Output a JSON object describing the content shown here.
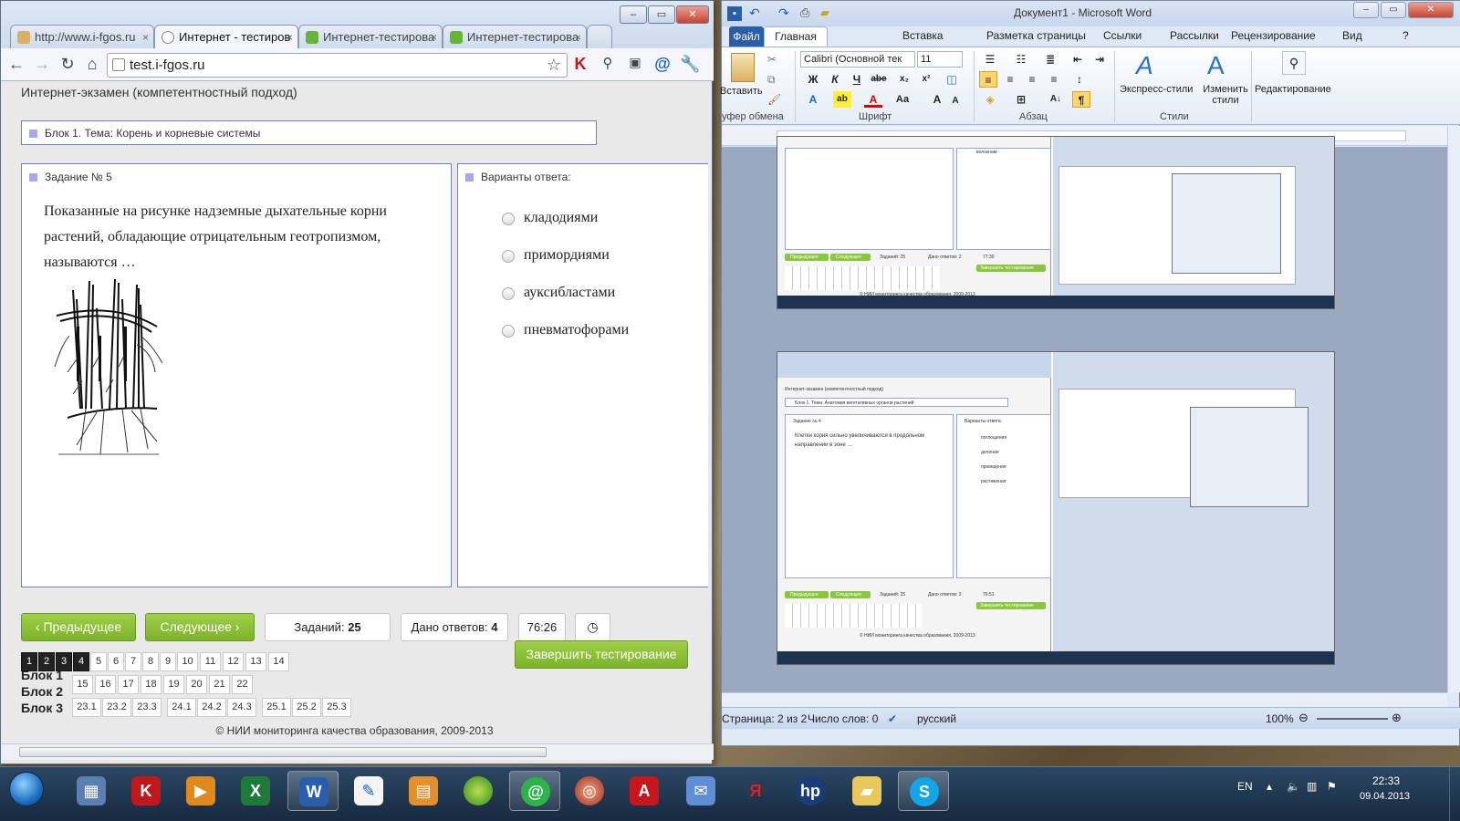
{
  "browser": {
    "tabs": [
      {
        "label": "http://www.i-fgos.ru",
        "active": false
      },
      {
        "label": "Интернет - тестиров",
        "active": true
      },
      {
        "label": "Интернет-тестирова",
        "active": false
      },
      {
        "label": "Интернет-тестирова",
        "active": false
      }
    ],
    "url": "test.i-fgos.ru"
  },
  "exam": {
    "page_title": "Интернет-экзамен (компетентностный подход)",
    "block_title": "Блок 1. Тема: Корень и корневые системы",
    "task_title": "Задание № 5",
    "question": "Показанные на рисунке надземные дыхательные корни растений, обладающие отрицательным геотропизмом, называются …",
    "answers_title": "Варианты ответа:",
    "options": [
      "кладодиями",
      "примордиями",
      "ауксибластами",
      "пневматофорами"
    ],
    "prev_label": "Предыдущее",
    "next_label": "Следующее",
    "tasks_label": "Заданий:",
    "tasks_count": "25",
    "answered_label": "Дано ответов:",
    "answered_count": "4",
    "timer": "76:26",
    "finish_label": "Завершить тестирование",
    "row1_nums": [
      "1",
      "2",
      "3",
      "4",
      "5",
      "6",
      "7",
      "8",
      "9",
      "10",
      "11",
      "12",
      "13",
      "14"
    ],
    "answered_nums": 4,
    "block_labels": [
      "Блок 1",
      "Блок 2",
      "Блок 3"
    ],
    "row2_nums": [
      "15",
      "16",
      "17",
      "18",
      "19",
      "20",
      "21",
      "22"
    ],
    "row3_nums": [
      "23.1",
      "23.2",
      "23.3",
      "24.1",
      "24.2",
      "24.3",
      "25.1",
      "25.2",
      "25.3"
    ],
    "copyright": "© НИИ мониторинга качества образования, 2009-2013"
  },
  "word": {
    "title": "Документ1  -  Microsoft Word",
    "tabs": [
      "Файл",
      "Главная",
      "Вставка",
      "Разметка страницы",
      "Ссылки",
      "Рассылки",
      "Рецензирование",
      "Вид"
    ],
    "font_name": "Calibri (Основной тек",
    "font_size": "11",
    "groups": {
      "clipboard": "уфер обмена",
      "paste": "Вставить",
      "font": "Шрифт",
      "paragraph": "Абзац",
      "styles": "Стили",
      "express_styles": "Экспресс-стили",
      "change_styles": "Изменить стили",
      "editing": "Редактирование"
    },
    "status": {
      "page": "Страница: 2 из 2",
      "words": "Число слов: 0",
      "lang": "русский",
      "zoom": "100%"
    }
  },
  "mini1": {
    "prev": "Предыдущее",
    "next": "Следующее",
    "tasks": "Заданий: 25",
    "answered": "Дано ответов: 2",
    "timer": "77:30",
    "finish": "Завершить тестирование",
    "copyright": "© НИИ мониторинга качества образования, 2009-2013",
    "option": "волокнам"
  },
  "mini2": {
    "page_title": "Интернет-экзамен (компетентностный подход)",
    "block_title": "Блок 1. Тема: Анатомия вегетативных органов растений",
    "task_title": "Задание № 4",
    "question": "Клетки корня сильно увеличиваются в продольном направлении в зоне …",
    "answers_title": "Варианты ответа:",
    "options": [
      "поглощения",
      "деления",
      "проведения",
      "растяжения"
    ],
    "prev": "Предыдущее",
    "next": "Следующее",
    "tasks": "Заданий: 25",
    "answered": "Дано ответов: 3",
    "timer": "76:51",
    "finish": "Завершить тестирование",
    "copyright": "© НИИ мониторинга качества образования, 2009-2013"
  },
  "taskbar": {
    "lang": "EN",
    "time": "22:33",
    "date": "09.04.2013"
  },
  "colors": {
    "accent_green": "#8cc63f",
    "panel_border": "#6f7fc9",
    "word_blue": "#2a5ea9"
  }
}
